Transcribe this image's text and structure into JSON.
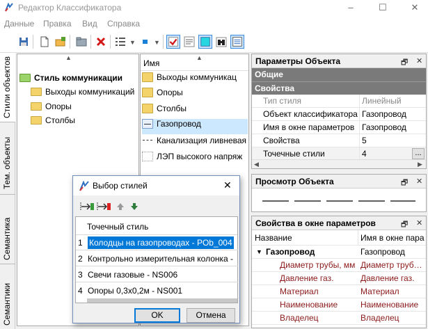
{
  "window": {
    "title": "Редактор Классификатора",
    "minimize": "–",
    "maximize": "☐",
    "close": "✕"
  },
  "menu": {
    "items": [
      "Данные",
      "Правка",
      "Вид",
      "Справка"
    ]
  },
  "side_tabs": [
    "Стили объектов",
    "Тем. объекты",
    "Семантика",
    "Семантики"
  ],
  "tree": {
    "root": "Стиль коммуникации",
    "children": [
      "Выходы коммуникаций",
      "Опоры",
      "Столбы"
    ]
  },
  "list": {
    "header": "Имя",
    "items": [
      {
        "label": "Выходы коммуникац",
        "icon": "folder"
      },
      {
        "label": "Опоры",
        "icon": "folder"
      },
      {
        "label": "Столбы",
        "icon": "folder"
      },
      {
        "label": "Газопровод",
        "icon": "line-style",
        "selected": true
      },
      {
        "label": "Канализация ливневая",
        "icon": "dash-style"
      },
      {
        "label": "ЛЭП высокого напряж",
        "icon": "dot-style"
      }
    ]
  },
  "params": {
    "title": "Параметры Объекта",
    "groups": [
      "Общие",
      "Свойства"
    ],
    "rows": [
      {
        "key": "Тип стиля",
        "value": "Линейный",
        "muted": true
      },
      {
        "key": "Объект классификатора",
        "value": "Газопровод"
      },
      {
        "key": "Имя в окне параметров",
        "value": "Газопровод"
      },
      {
        "key": "Свойства",
        "value": "5"
      },
      {
        "key": "Точечные стили",
        "value": "4",
        "button": "..."
      }
    ]
  },
  "preview": {
    "title": "Просмотр Объекта"
  },
  "props_window": {
    "title": "Свойства в окне параметров",
    "col_name": "Название",
    "col_name2": "Имя в окне пара",
    "group": {
      "key": "Газопровод",
      "value": "Газопровод"
    },
    "rows": [
      {
        "key": "Диаметр трубы, мм",
        "value": "Диаметр труб…"
      },
      {
        "key": "Давление газ.",
        "value": "Давление газ."
      },
      {
        "key": "Материал",
        "value": "Материал"
      },
      {
        "key": "Наименование",
        "value": "Наименование"
      },
      {
        "key": "Владелец",
        "value": "Владелец"
      }
    ]
  },
  "dialog": {
    "title": "Выбор стилей",
    "close": "✕",
    "column": "Точечный стиль",
    "rows": [
      {
        "n": "1",
        "text": "Колодцы на газопроводах - POb_004",
        "selected": true
      },
      {
        "n": "2",
        "text": "Контрольно измерительная колонка -"
      },
      {
        "n": "3",
        "text": "Свечи  газовые - NS006"
      },
      {
        "n": "4",
        "text": "Опоры 0,3х0,2м - NS001"
      }
    ],
    "ok": "OK",
    "cancel": "Отмена"
  },
  "colors": {
    "selection": "#cce8ff",
    "highlight": "#0078d7",
    "group_header": "#7a7a7a",
    "dark_red": "#8b1a1a"
  }
}
